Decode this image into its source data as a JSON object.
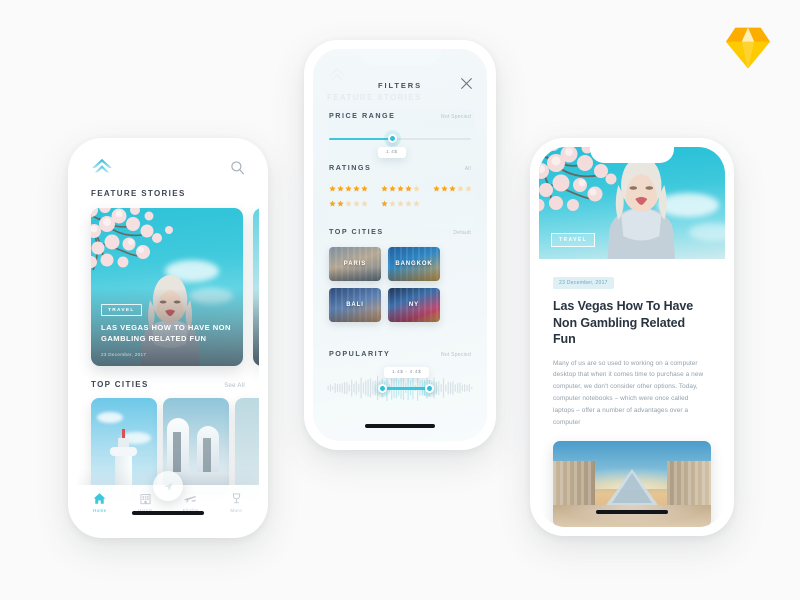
{
  "canvas": {
    "background": "#fafafa",
    "accent": "#3ec6dd",
    "star_color": "#f5a623"
  },
  "branding": {
    "logo_name": "sketch-logo"
  },
  "phone_home": {
    "brand_icon": "chevron-up-logo",
    "search_icon": "search-icon",
    "sections": [
      {
        "title": "FEATURE STORIES",
        "link": ""
      },
      {
        "title": "TOP CITIES",
        "link": "See All"
      }
    ],
    "feature_card": {
      "badge": "TRAVEL",
      "title": "LAS VEGAS HOW TO HAVE NON GAMBLING RELATED FUN",
      "date": "23 December, 2017"
    },
    "tabs": [
      {
        "label": "Home",
        "icon": "home-icon",
        "active": true
      },
      {
        "label": "Hotels",
        "icon": "hotel-icon",
        "active": false
      },
      {
        "label": "Flights",
        "icon": "plane-icon",
        "active": false
      },
      {
        "label": "More",
        "icon": "more-icon",
        "active": false
      }
    ]
  },
  "phone_filters": {
    "title": "FILTERS",
    "close_icon": "close-icon",
    "ghost_title": "FEATURE STORIES",
    "price_range": {
      "label": "PRICE RANGE",
      "meta": "Not Specied",
      "tooltip": "1.4$",
      "fill_percent": 45
    },
    "ratings": {
      "label": "RATINGS",
      "meta": "All",
      "options": [
        5,
        4,
        3,
        2,
        1
      ]
    },
    "top_cities": {
      "label": "TOP CITIES",
      "meta": "Default",
      "cities": [
        "PARIS",
        "BANGKOK",
        "BALI",
        "NY"
      ]
    },
    "popularity": {
      "label": "POPULARITY",
      "meta": "Not Specied",
      "tooltip": "1.4$ - 4.4$",
      "low_percent": 38,
      "high_percent": 70
    }
  },
  "phone_article": {
    "badge": "TRAVEL",
    "date": "23 December, 2017",
    "title": "Las Vegas How To Have Non Gambling Related Fun",
    "paragraph": "Many of us are so used to working on a computer desktop that when it comes time to purchase a new computer, we don't consider other options. Today, computer notebooks – which were once called laptops – offer a number of advantages over a computer",
    "photo_name": "louvre-pyramid-photo"
  }
}
